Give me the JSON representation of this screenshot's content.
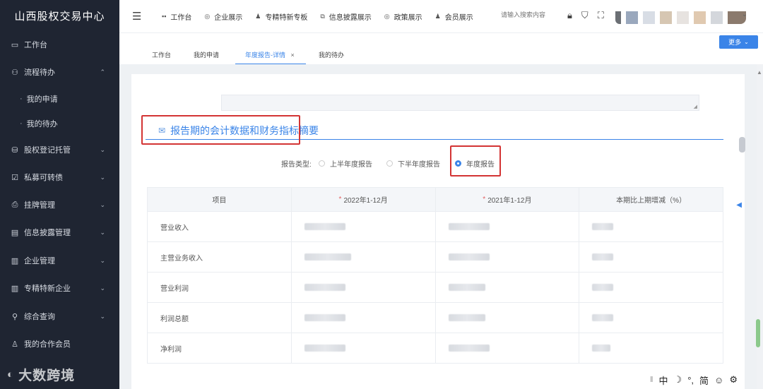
{
  "sidebar": {
    "brand": "山西股权交易中心",
    "items": [
      {
        "label": "工作台",
        "icon": "monitor-icon"
      },
      {
        "label": "流程待办",
        "icon": "flow-icon",
        "expanded": true
      },
      {
        "label": "我的申请",
        "sub": true
      },
      {
        "label": "我的待办",
        "sub": true
      },
      {
        "label": "股权登记托管",
        "icon": "stock-icon"
      },
      {
        "label": "私募可转债",
        "icon": "bond-icon"
      },
      {
        "label": "挂牌管理",
        "icon": "tag-icon"
      },
      {
        "label": "信息披露管理",
        "icon": "doc-icon"
      },
      {
        "label": "企业管理",
        "icon": "building-icon"
      },
      {
        "label": "专精特新企业",
        "icon": "building-icon"
      },
      {
        "label": "综合查询",
        "icon": "search-icon"
      },
      {
        "label": "我的合作会员",
        "icon": "member-icon"
      }
    ]
  },
  "topnav": {
    "items": [
      "工作台",
      "企业展示",
      "专精特新专板",
      "信息披露展示",
      "政策展示",
      "会员展示"
    ],
    "search_placeholder": "请输入搜索内容"
  },
  "tabs": {
    "items": [
      "工作台",
      "我的申请",
      "年度报告-详情",
      "我的待办"
    ],
    "active_close": "×",
    "more_label": "更多"
  },
  "section": {
    "title": "报告期的会计数据和财务指标摘要",
    "report_type_label": "报告类型:",
    "options": [
      "上半年度报告",
      "下半年度报告",
      "年度报告"
    ],
    "selected": "年度报告"
  },
  "table": {
    "headers": [
      "项目",
      "2022年1-12月",
      "2021年1-12月",
      "本期比上期增减（%）"
    ],
    "rows": [
      "营业收入",
      "主营业务收入",
      "营业利润",
      "利润总额",
      "净利润"
    ]
  },
  "watermark": "大数跨境",
  "ime": [
    "中",
    "☽",
    "°,",
    "简",
    "☺",
    "⚙"
  ],
  "colors": {
    "sidebar_bg": "#1f2532",
    "accent": "#3a84e8",
    "highlight": "#d33434"
  }
}
